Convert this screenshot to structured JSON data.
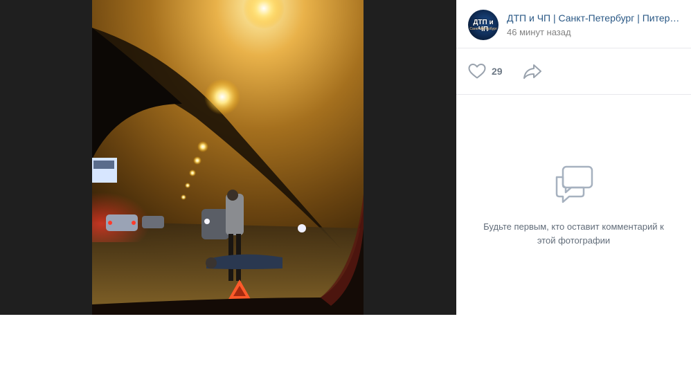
{
  "post": {
    "group_name": "ДТП и ЧП | Санкт-Петербург | Питер Онлайн | СПб",
    "time": "46 минут назад",
    "avatar": {
      "title": "ДТП и ЧП",
      "subtitle": "Санкт-Петербург",
      "icon": "avatar-image"
    }
  },
  "actions": {
    "likes": "29",
    "like_icon": "heart-icon",
    "share_icon": "share-arrow-icon"
  },
  "comments": {
    "icon": "comment-bubbles-icon",
    "empty_text": "Будьте первым, кто оставит комментарий к этой фотографии"
  },
  "colors": {
    "link": "#2a5885",
    "muted": "#828282",
    "icon": "#99a2ad",
    "viewer_bg": "#1f1f1f"
  }
}
